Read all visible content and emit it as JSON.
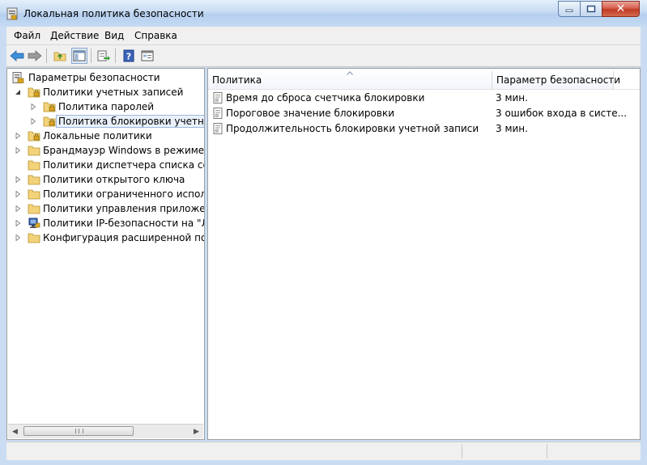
{
  "window": {
    "title": "Локальная политика безопасности",
    "close_label": "✕"
  },
  "menu": [
    {
      "label": "Файл"
    },
    {
      "label": "Действие"
    },
    {
      "label": "Вид"
    },
    {
      "label": "Справка"
    }
  ],
  "toolbar": {
    "buttons": [
      "back-icon",
      "forward-icon",
      "up-folder-icon",
      "show-hide-tree-icon",
      "export-list-icon",
      "help-icon",
      "properties-icon"
    ]
  },
  "tree": {
    "root": "Параметры безопасности",
    "items": [
      {
        "label": "Политики учетных записей",
        "level": 1,
        "expanded": true
      },
      {
        "label": "Политика паролей",
        "level": 2
      },
      {
        "label": "Политика блокировки учетной зап",
        "level": 2,
        "selected": true
      },
      {
        "label": "Локальные политики",
        "level": 1
      },
      {
        "label": "Брандмауэр Windows в режиме пов",
        "level": 1
      },
      {
        "label": "Политики диспетчера списка сетей",
        "level": 1
      },
      {
        "label": "Политики открытого ключа",
        "level": 1
      },
      {
        "label": "Политики ограниченного использо",
        "level": 1
      },
      {
        "label": "Политики управления приложения",
        "level": 1
      },
      {
        "label": "Политики IP-безопасности на \"Лока",
        "level": 1
      },
      {
        "label": "Конфигурация расширенной полит",
        "level": 1
      }
    ]
  },
  "list": {
    "columns": [
      "Политика",
      "Параметр безопасности"
    ],
    "rows": [
      {
        "name": "Время до сброса счетчика блокировки",
        "value": "3 мин."
      },
      {
        "name": "Пороговое значение блокировки",
        "value": "3 ошибок входа в систе..."
      },
      {
        "name": "Продолжительность блокировки учетной записи",
        "value": "3 мин."
      }
    ]
  },
  "colors": {
    "accent": "#3399ff",
    "folder": "#f2d37a",
    "lock": "#d9a520"
  }
}
